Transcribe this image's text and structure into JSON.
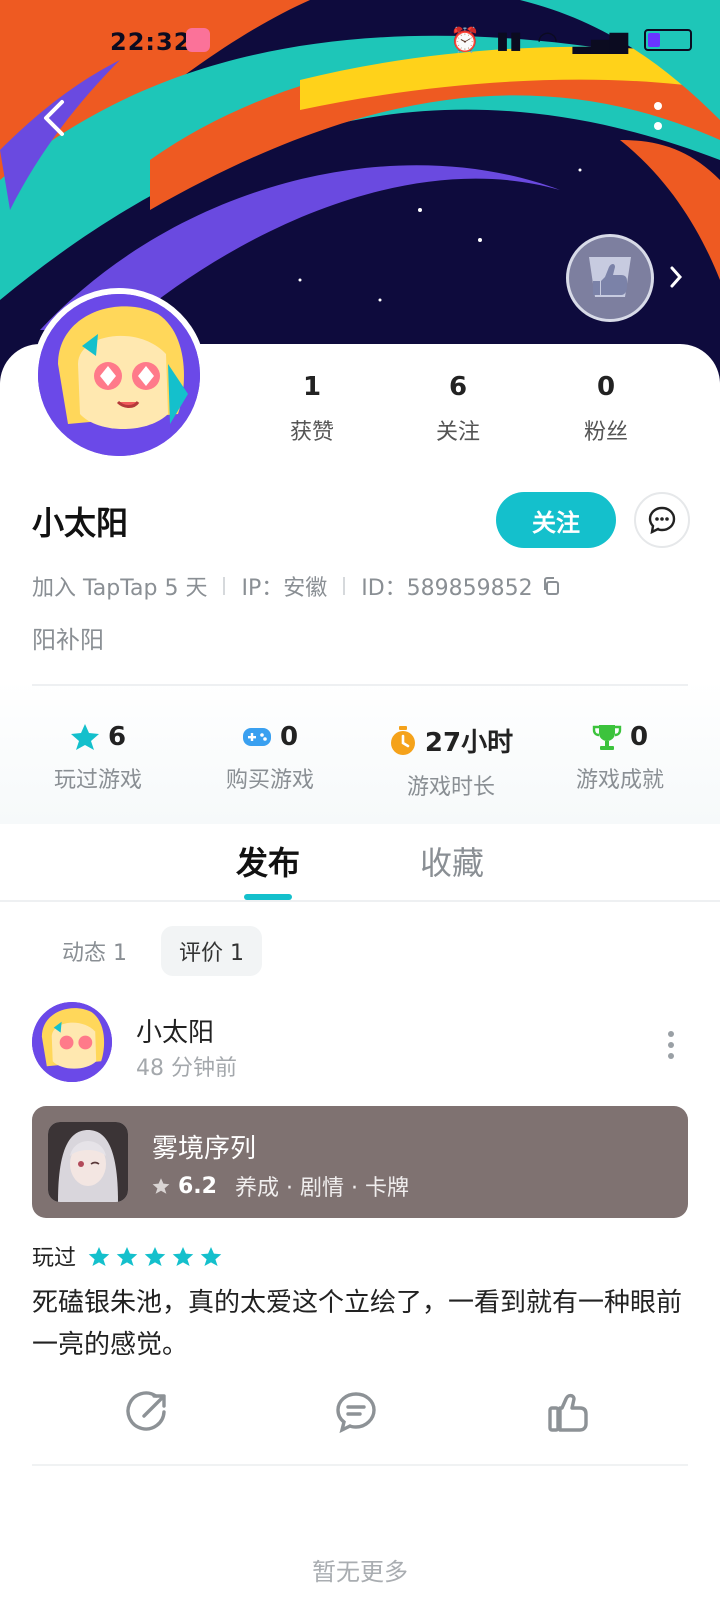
{
  "status_bar": {
    "time": "22:32"
  },
  "profile": {
    "stats": [
      {
        "value": "1",
        "label": "获赞"
      },
      {
        "value": "6",
        "label": "关注"
      },
      {
        "value": "0",
        "label": "粉丝"
      }
    ],
    "username": "小太阳",
    "follow_label": "关注",
    "joined": "加入 TapTap 5 天",
    "ip": "IP：安徽",
    "id": "ID：589859852",
    "bio": "阳补阳"
  },
  "game_stats": [
    {
      "value": "6",
      "label": "玩过游戏",
      "icon": "star-icon",
      "color": "#14c0cc"
    },
    {
      "value": "0",
      "label": "购买游戏",
      "icon": "gamepad-icon",
      "color": "#3aa0f0"
    },
    {
      "value": "27小时",
      "label": "游戏时长",
      "icon": "stopwatch-icon",
      "color": "#f5a21a"
    },
    {
      "value": "0",
      "label": "游戏成就",
      "icon": "trophy-icon",
      "color": "#3cc33c"
    }
  ],
  "tabs": {
    "active": "发布",
    "inactive": "收藏"
  },
  "subtabs": {
    "feed": "动态 1",
    "reviews": "评价 1"
  },
  "post": {
    "author": "小太阳",
    "time": "48 分钟前",
    "game": {
      "name": "雾境序列",
      "score": "6.2",
      "tags": "养成 · 剧情 · 卡牌"
    },
    "played_label": "玩过",
    "rating": 5,
    "text": "死磕银朱池，真的太爱这个立绘了，一看到就有一种眼前一亮的感觉。"
  },
  "footer": {
    "no_more": "暂无更多"
  },
  "colors": {
    "accent": "#14c0cc",
    "game_card_bg": "#7f7271"
  }
}
